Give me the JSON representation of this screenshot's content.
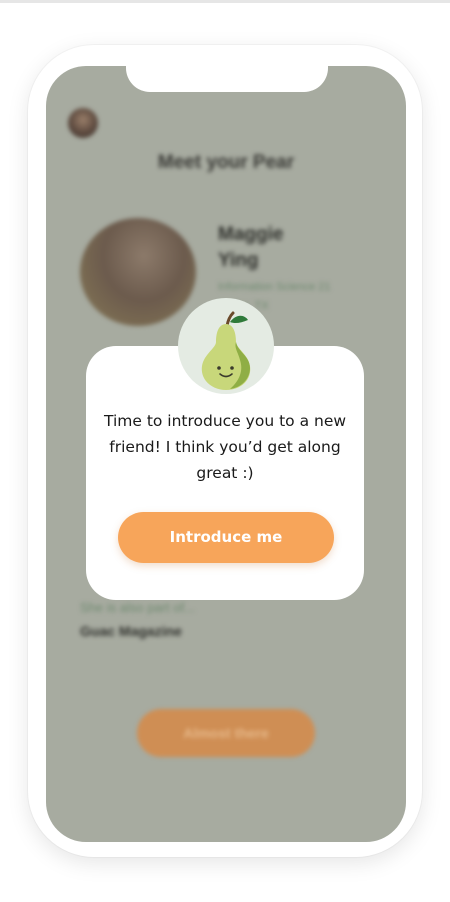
{
  "background": {
    "page_title": "Meet your Pear",
    "profile": {
      "name_line1": "Maggie",
      "name_line2": "Ying",
      "meta_line1": "Information Science 21",
      "meta_line2": "Dallas, TX"
    },
    "also_part_of_label": "She is also part of...",
    "org_name": "Guac Magazine",
    "primary_button_label": "Almost there"
  },
  "modal": {
    "icon": "pear-mascot-icon",
    "message": "Time to introduce you to a new friend! I think you’d get along great :)",
    "button_label": "Introduce me"
  },
  "colors": {
    "accent_orange": "#f7a55a",
    "overlay_sage": "#a7aba0",
    "pear_green": "#c8d77a"
  }
}
